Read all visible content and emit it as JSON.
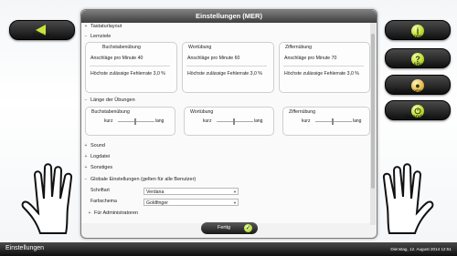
{
  "dialog_title": "Einstellungen (MER)",
  "left_buttons": [
    {
      "label": "Zurück",
      "icon": "arrow-left-icon"
    }
  ],
  "right_buttons": [
    {
      "label": "Info",
      "icon": "info-icon"
    },
    {
      "label": "Hilfe",
      "icon": "help-icon"
    },
    {
      "label": "Benutzerwechsel",
      "icon": "users-icon"
    },
    {
      "label": "Beenden",
      "icon": "power-icon"
    }
  ],
  "sections": {
    "tastaturlayout": "Tastaturlayout",
    "lernziele": "Lernziele",
    "laenge": "Länge der Übungen",
    "sound": "Sound",
    "logdatei": "Logdatei",
    "sonstiges": "Sonstiges",
    "global": "Globale Einstellungen (gelten für alle Benutzer)",
    "admin": "Für Administratoren"
  },
  "lernziele_boxes": [
    {
      "title": "Buchstabenübung",
      "anschlaege": "Anschläge pro Minute 40",
      "fehler": "Höchste zulässige Fehlerrate 3,0 %"
    },
    {
      "title": "Wortübung",
      "anschlaege": "Anschläge pro Minute 60",
      "fehler": "Höchste zulässige Fehlerrate 3,0 %"
    },
    {
      "title": "Ziffernübung",
      "anschlaege": "Anschläge pro Minute 70",
      "fehler": "Höchste zulässige Fehlerrate 3,0 %"
    }
  ],
  "laenge_boxes": [
    {
      "title": "Buchstabenübung",
      "short": "kurz",
      "long": "lang"
    },
    {
      "title": "Wortübung",
      "short": "kurz",
      "long": "lang"
    },
    {
      "title": "Ziffernübung",
      "short": "kurz",
      "long": "lang"
    }
  ],
  "global": {
    "schriftart_label": "Schriftart",
    "schriftart_value": "Verdana",
    "farbschema_label": "Farbschema",
    "farbschema_value": "Goldfinger"
  },
  "ok_label": "Fertig",
  "status": {
    "left": "Einstellungen",
    "right": "Dienstag, 12. August 2014 12:51"
  },
  "colors": {
    "accent": "#b7d82a",
    "bar": "#1e1e1e"
  }
}
